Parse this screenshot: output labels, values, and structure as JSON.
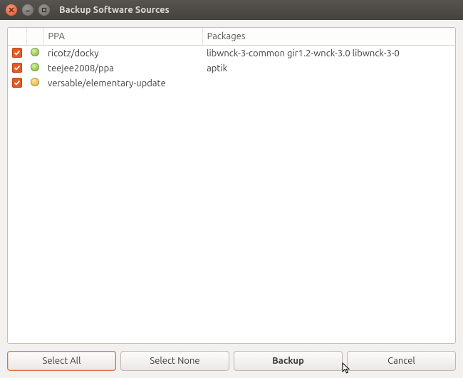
{
  "window": {
    "title": "Backup Software Sources"
  },
  "columns": {
    "chk": "",
    "status": "",
    "ppa": "PPA",
    "packages": "Packages"
  },
  "rows": [
    {
      "checked": true,
      "status": "green",
      "ppa": "ricotz/docky",
      "packages": "libwnck-3-common gir1.2-wnck-3.0 libwnck-3-0"
    },
    {
      "checked": true,
      "status": "green",
      "ppa": "teejee2008/ppa",
      "packages": "aptik"
    },
    {
      "checked": true,
      "status": "yellow",
      "ppa": "versable/elementary-update",
      "packages": ""
    }
  ],
  "buttons": {
    "select_all": "Select All",
    "select_none": "Select None",
    "backup": "Backup",
    "cancel": "Cancel"
  }
}
